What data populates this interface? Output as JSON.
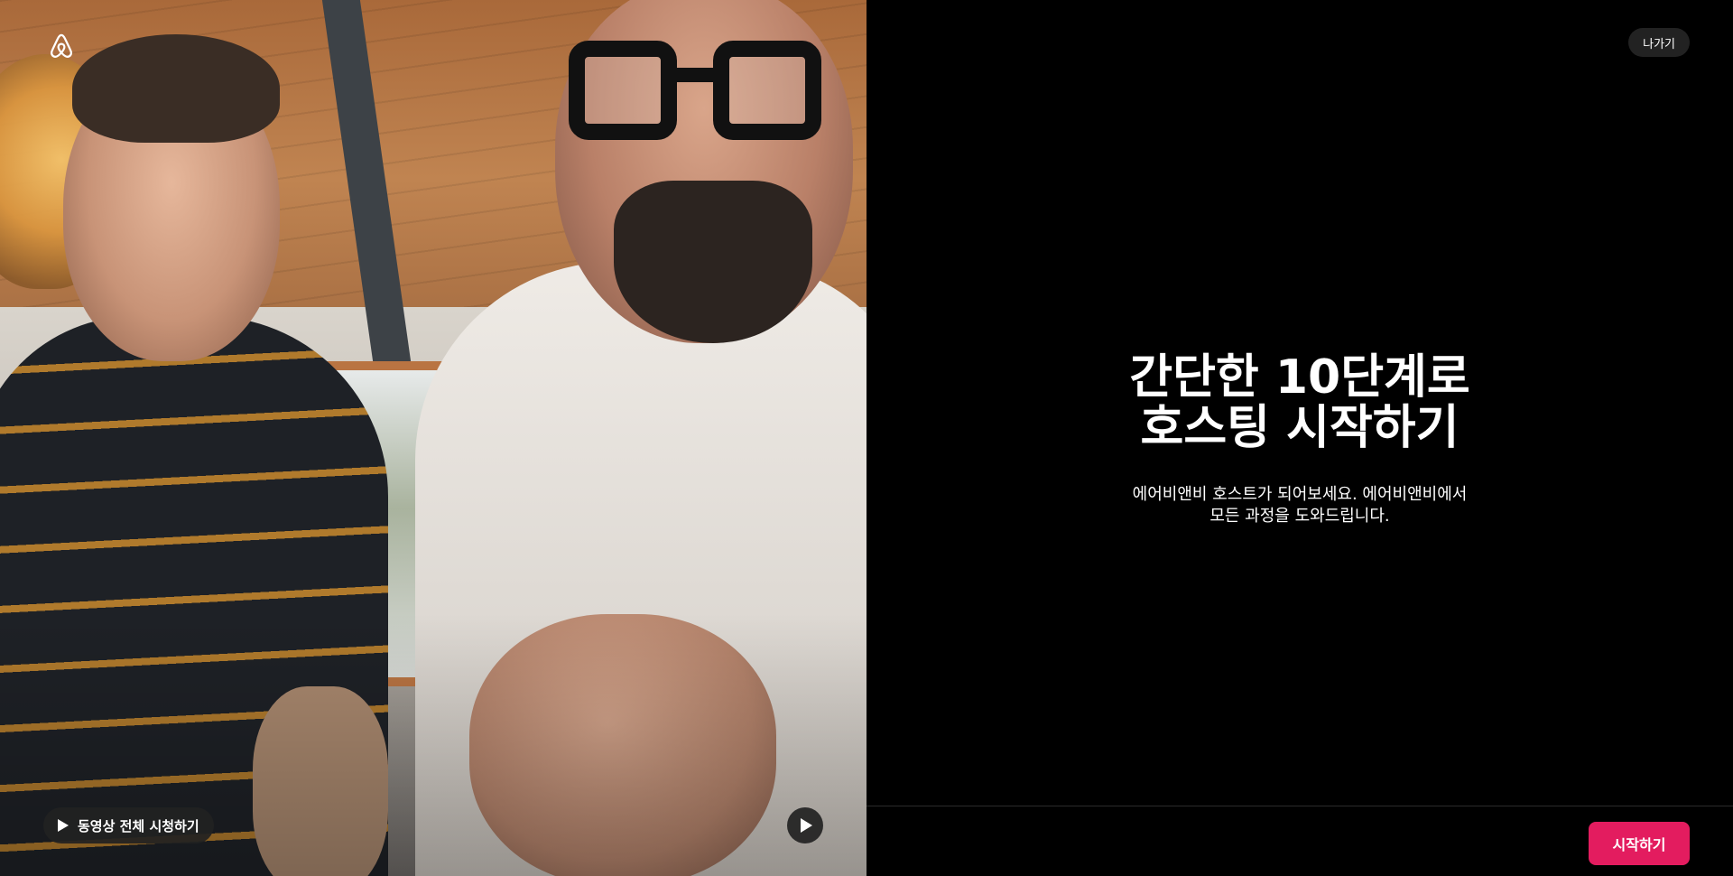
{
  "brand": {
    "logo_icon": "airbnb-logo-icon",
    "accent_color": "#E31C5F"
  },
  "video": {
    "watch_full_label": "동영상 전체 시청하기",
    "play_icon": "play-icon"
  },
  "header": {
    "exit_label": "나가기"
  },
  "hero": {
    "title_line1": "간단한 10단계로",
    "title_line2": "호스팅 시작하기",
    "subtitle_line1": "에어비앤비 호스트가 되어보세요. 에어비앤비에서",
    "subtitle_line2": "모든 과정을 도와드립니다."
  },
  "footer": {
    "start_label": "시작하기"
  }
}
